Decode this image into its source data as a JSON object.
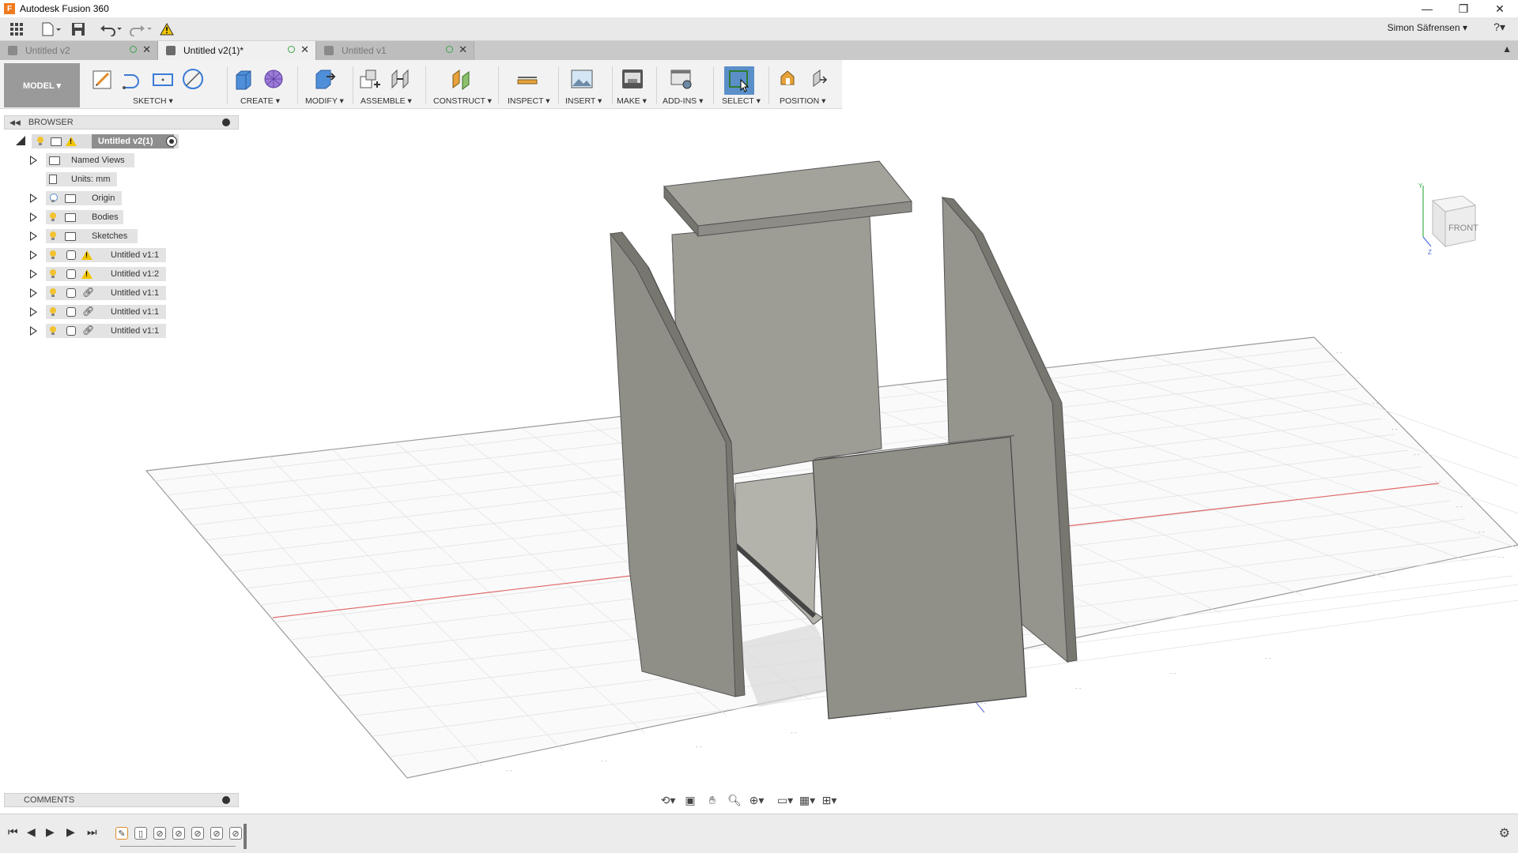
{
  "window": {
    "title": "Autodesk Fusion 360",
    "controls": [
      "minimize-icon",
      "restore-icon",
      "close-icon"
    ]
  },
  "quick_access": {
    "user_name": "Simon Säfrensen ▾",
    "help": "?▾"
  },
  "tabs": [
    {
      "label": "Untitled v2",
      "active": false
    },
    {
      "label": "Untitled v2(1)*",
      "active": true
    },
    {
      "label": "Untitled v1",
      "active": false
    }
  ],
  "toolbar": {
    "workspace": "MODEL ▾",
    "groups": [
      "SKETCH ▾",
      "CREATE ▾",
      "MODIFY ▾",
      "ASSEMBLE ▾",
      "CONSTRUCT ▾",
      "INSPECT ▾",
      "INSERT ▾",
      "MAKE ▾",
      "ADD-INS ▾",
      "SELECT ▾",
      "POSITION ▾"
    ]
  },
  "browser": {
    "title": "BROWSER",
    "root": "Untitled v2(1)",
    "items": [
      {
        "label": "Named Views"
      },
      {
        "label": "Units: mm"
      },
      {
        "label": "Origin"
      },
      {
        "label": "Bodies"
      },
      {
        "label": "Sketches"
      },
      {
        "label": "Untitled v1:1"
      },
      {
        "label": "Untitled v1:2"
      },
      {
        "label": "Untitled v1:1"
      },
      {
        "label": "Untitled v1:1"
      },
      {
        "label": "Untitled v1:1"
      }
    ]
  },
  "viewcube": {
    "face": "FRONT"
  },
  "comments": {
    "title": "COMMENTS"
  },
  "colors": {
    "accent_select": "#5a8fc8",
    "panel_bg": "#f2f2f2",
    "body_color": "#8e8d86",
    "warning": "#f2c500"
  }
}
